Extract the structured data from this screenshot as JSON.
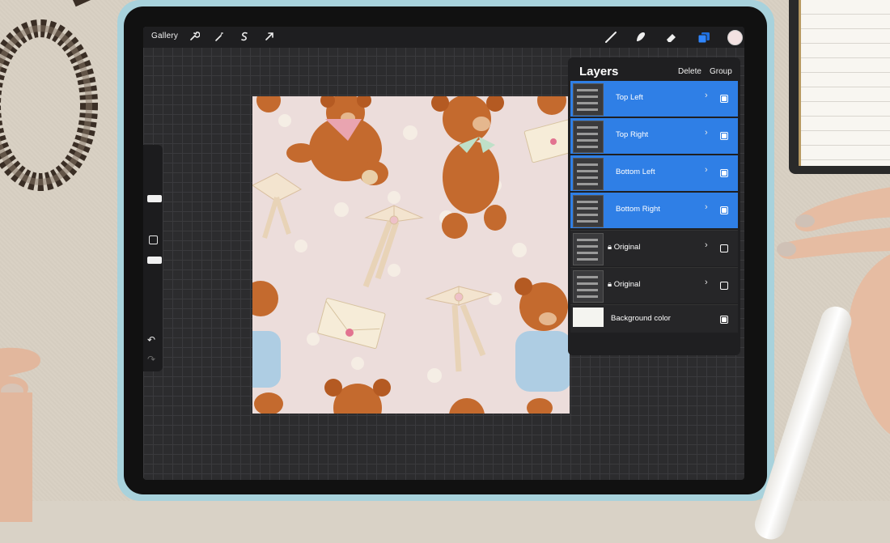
{
  "toolbar": {
    "gallery_label": "Gallery",
    "icons": [
      "wrench-icon",
      "magic-wand-icon",
      "selection-icon",
      "transform-arrow-icon"
    ],
    "right_icons": [
      "brush-icon",
      "smudge-icon",
      "eraser-icon",
      "layers-icon"
    ],
    "accent_color": "#2f7fe6",
    "current_color": "#f3e2e2"
  },
  "layers_panel": {
    "title": "Layers",
    "delete_label": "Delete",
    "group_label": "Group",
    "items": [
      {
        "name": "Top Left",
        "selected": true,
        "locked": false,
        "visible": true
      },
      {
        "name": "Top Right",
        "selected": true,
        "locked": false,
        "visible": true
      },
      {
        "name": "Bottom Left",
        "selected": true,
        "locked": false,
        "visible": true
      },
      {
        "name": "Bottom Right",
        "selected": true,
        "locked": false,
        "visible": true
      },
      {
        "name": "Original",
        "selected": false,
        "locked": true,
        "visible": false
      },
      {
        "name": "Original",
        "selected": false,
        "locked": true,
        "visible": false
      }
    ],
    "background": {
      "name": "Background color",
      "visible": true
    }
  }
}
